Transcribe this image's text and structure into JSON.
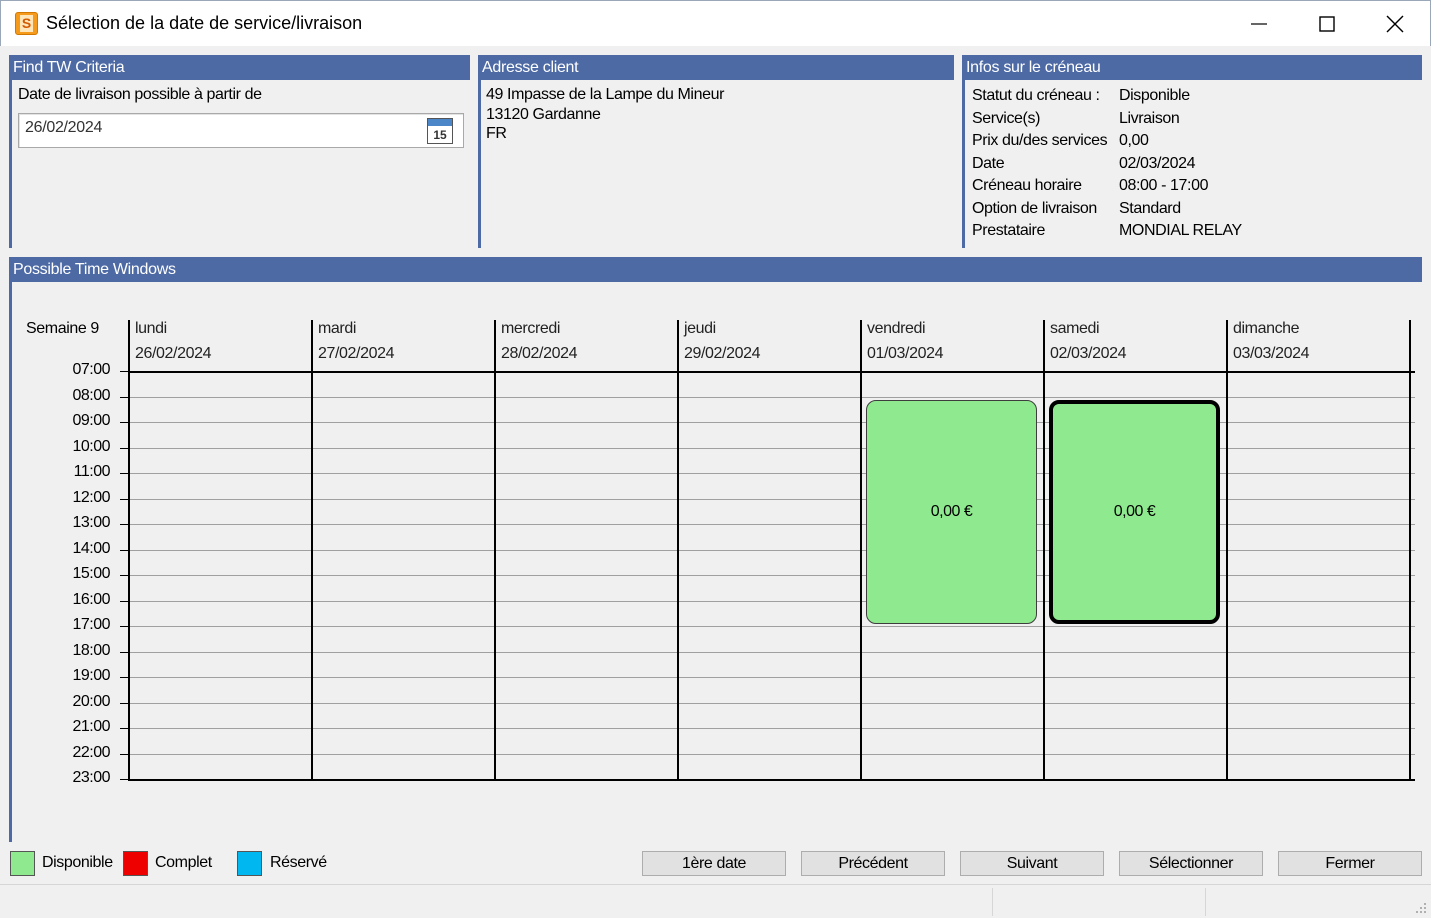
{
  "window": {
    "icon_letter": "S",
    "title": "Sélection de la date de service/livraison"
  },
  "criteria": {
    "header": "Find TW Criteria",
    "date_label": "Date de livraison possible à partir de",
    "date_value": "26/02/2024",
    "calendar_day": "15"
  },
  "address": {
    "header": "Adresse client",
    "line1": "49 Impasse de la Lampe du Mineur",
    "line2": "13120 Gardanne",
    "line3": "FR"
  },
  "slot_info": {
    "header": "Infos sur le créneau",
    "rows": [
      {
        "label": "Statut du créneau :",
        "value": "Disponible"
      },
      {
        "label": "Service(s)",
        "value": "Livraison"
      },
      {
        "label": "Prix du/des services",
        "value": "0,00"
      },
      {
        "label": "Date",
        "value": "02/03/2024"
      },
      {
        "label": "Créneau horaire",
        "value": "08:00 - 17:00"
      },
      {
        "label": "Option de livraison",
        "value": "Standard"
      },
      {
        "label": "Prestataire",
        "value": "MONDIAL RELAY"
      }
    ]
  },
  "schedule": {
    "header": "Possible Time Windows",
    "week_label": "Semaine 9",
    "hours": [
      "07:00",
      "08:00",
      "09:00",
      "10:00",
      "11:00",
      "12:00",
      "13:00",
      "14:00",
      "15:00",
      "16:00",
      "17:00",
      "18:00",
      "19:00",
      "20:00",
      "21:00",
      "22:00",
      "23:00"
    ],
    "days": [
      {
        "name": "lundi",
        "date": "26/02/2024"
      },
      {
        "name": "mardi",
        "date": "27/02/2024"
      },
      {
        "name": "mercredi",
        "date": "28/02/2024"
      },
      {
        "name": "jeudi",
        "date": "29/02/2024"
      },
      {
        "name": "vendredi",
        "date": "01/03/2024"
      },
      {
        "name": "samedi",
        "date": "02/03/2024"
      },
      {
        "name": "dimanche",
        "date": "03/03/2024"
      }
    ],
    "slots": [
      {
        "day_index": 4,
        "start": "08:00",
        "end": "17:00",
        "price": "0,00 €",
        "status": "Disponible",
        "selected": false
      },
      {
        "day_index": 5,
        "start": "08:00",
        "end": "17:00",
        "price": "0,00 €",
        "status": "Disponible",
        "selected": true
      }
    ]
  },
  "legend": [
    {
      "label": "Disponible",
      "color": "#8fea8f"
    },
    {
      "label": "Complet",
      "color": "#ee0000"
    },
    {
      "label": "Réservé",
      "color": "#00b7f0"
    }
  ],
  "buttons": {
    "first_date": "1ère date",
    "previous": "Précédent",
    "next": "Suivant",
    "select": "Sélectionner",
    "close": "Fermer"
  }
}
